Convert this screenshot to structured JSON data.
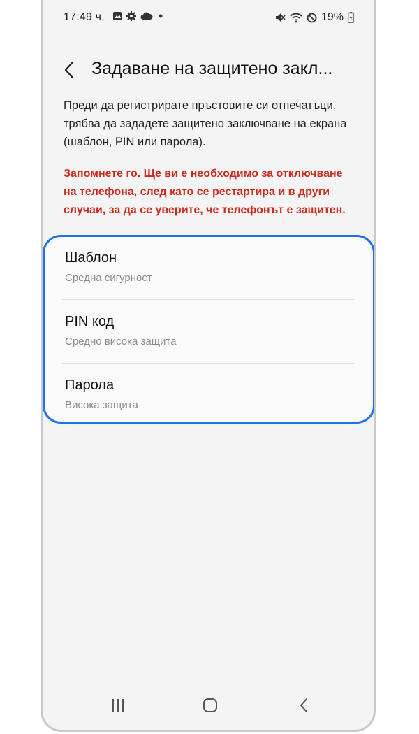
{
  "status_bar": {
    "time": "17:49 ч.",
    "battery": "19%",
    "icons_left": [
      "gallery-icon",
      "settings-gear-icon",
      "cloud-icon",
      "dot-icon"
    ],
    "icons_right": [
      "mute-icon",
      "wifi-icon",
      "no-sim-icon",
      "battery-icon"
    ]
  },
  "header": {
    "title": "Задаване на защитено закл..."
  },
  "description": "Преди да регистрирате пръстовите си отпечатъци, трябва да зададете защитено заключване на екрана (шаблон, PIN или парола).",
  "warning": "Запомнете го. Ще ви е необходимо за отключване на телефона, след като се рестартира и в други случаи, за да се уверите, че телефонът е защитен.",
  "options": [
    {
      "title": "Шаблон",
      "subtitle": "Средна сигурност"
    },
    {
      "title": "PIN код",
      "subtitle": "Средно висока защита"
    },
    {
      "title": "Парола",
      "subtitle": "Висока защита"
    }
  ],
  "colors": {
    "warning": "#cc2a1f",
    "highlight": "#1a73e8",
    "screen_bg": "#f4f4f4"
  },
  "navbar": [
    "recent-apps-icon",
    "home-icon",
    "back-icon"
  ]
}
